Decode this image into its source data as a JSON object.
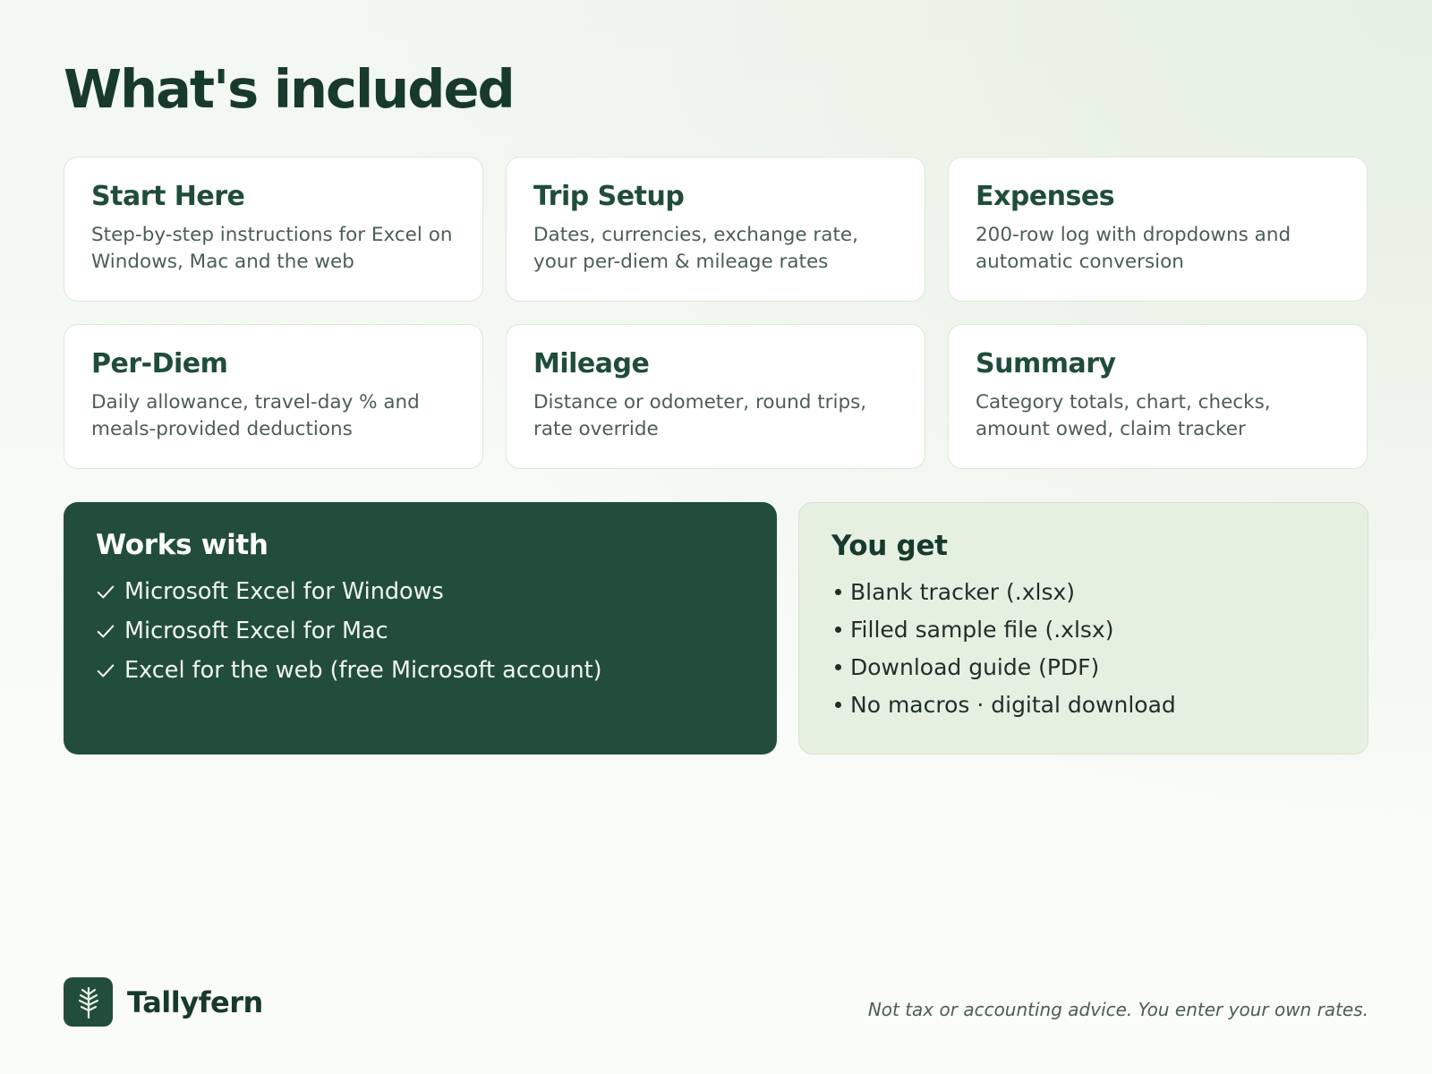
{
  "header": {
    "title": "What's included"
  },
  "cards": [
    {
      "title": "Start Here",
      "description": "Step-by-step instructions for Excel on Windows, Mac and the web"
    },
    {
      "title": "Trip Setup",
      "description": "Dates, currencies, exchange rate, your per-diem & mileage rates"
    },
    {
      "title": "Expenses",
      "description": "200-row log with dropdowns and automatic conversion"
    },
    {
      "title": "Per-Diem",
      "description": "Daily allowance, travel-day % and meals-provided deductions"
    },
    {
      "title": "Mileage",
      "description": "Distance or odometer, round trips, rate override"
    },
    {
      "title": "Summary",
      "description": "Category totals, chart, checks, amount owed, claim tracker"
    }
  ],
  "works_with": {
    "title": "Works with",
    "icon": "check-icon",
    "items": [
      "Microsoft Excel for Windows",
      "Microsoft Excel for Mac",
      "Excel for the web (free Microsoft account)"
    ]
  },
  "you_get": {
    "title": "You get",
    "icon": "bullet-icon",
    "items": [
      "Blank tracker (.xlsx)",
      "Filled sample file (.xlsx)",
      "Download guide (PDF)",
      "No macros · digital download"
    ]
  },
  "footer": {
    "brand_name": "Tallyfern",
    "logo_icon": "fern-leaf-icon",
    "disclaimer": "Not tax or accounting advice. You enter your own rates."
  },
  "colors": {
    "brand_dark_green": "#224d3b",
    "heading_green": "#173a2c",
    "light_green_panel": "#e5f0e1",
    "card_background": "#ffffff"
  }
}
